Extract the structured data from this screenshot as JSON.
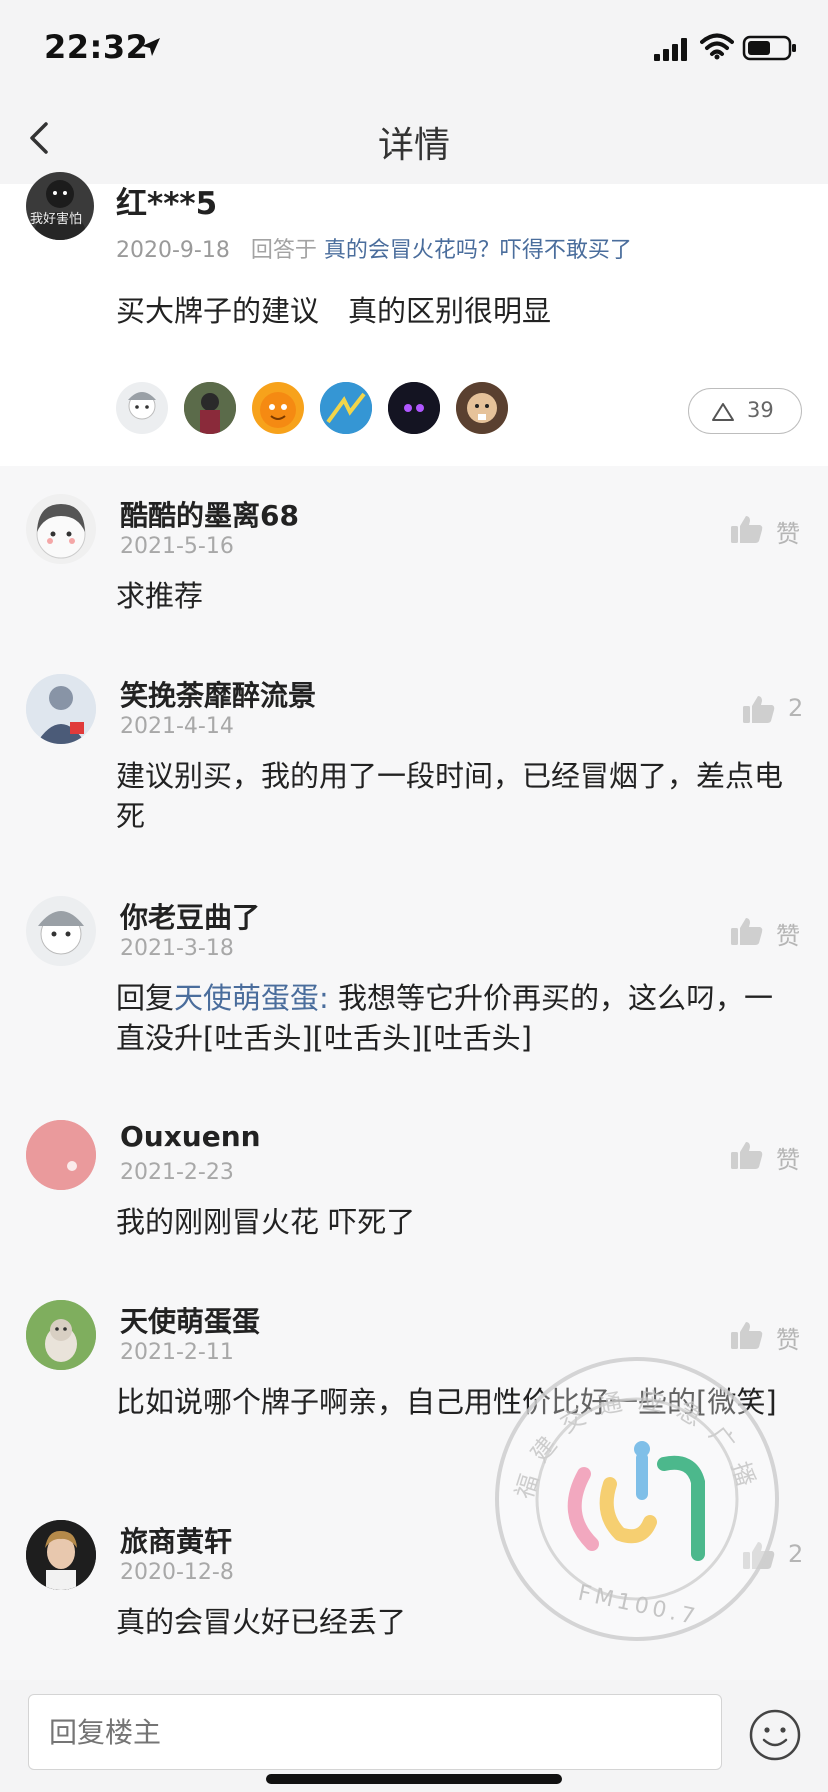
{
  "status_bar": {
    "time": "22:32"
  },
  "header": {
    "title": "详情"
  },
  "post": {
    "author": "红***5",
    "date": "2020-9-18",
    "answer_prefix": "回答于",
    "question": "真的会冒火花吗？吓得不敢买了",
    "body": "买大牌子的建议　真的区别很明显",
    "avatar_text": "我好害怕",
    "like_count": "39"
  },
  "comments": [
    {
      "name": "酷酷的墨离68",
      "date": "2021-5-16",
      "text": "求推荐",
      "like": "赞"
    },
    {
      "name": "笑挽荼靡醉流景",
      "date": "2021-4-14",
      "text": "建议别买，我的用了一段时间，已经冒烟了，差点电死",
      "like": "2"
    },
    {
      "name": "你老豆曲了",
      "date": "2021-3-18",
      "reply_prefix": "回复",
      "mention": "天使萌蛋蛋:",
      "text": " 我想等它升价再买的，这么叼，一直没升[吐舌头][吐舌头][吐舌头]",
      "like": "赞"
    },
    {
      "name": "Ouxuenn",
      "date": "2021-2-23",
      "text": "我的刚刚冒火花 吓死了",
      "like": "赞"
    },
    {
      "name": "天使萌蛋蛋",
      "date": "2021-2-11",
      "text": "比如说哪个牌子啊亲，自己用性价比好一些的[微笑]",
      "like": "赞"
    },
    {
      "name": "旅商黄轩",
      "date": "2020-12-8",
      "text": "真的会冒火好已经丢了",
      "like": "2"
    }
  ],
  "reply": {
    "placeholder": "回复楼主"
  },
  "watermark": {
    "ring_text": "福建交通应急广播",
    "sub_text": "FM100.7"
  },
  "colors": {
    "link": "#4a6d9c",
    "background": "#f7f7f8",
    "text": "#222222"
  }
}
